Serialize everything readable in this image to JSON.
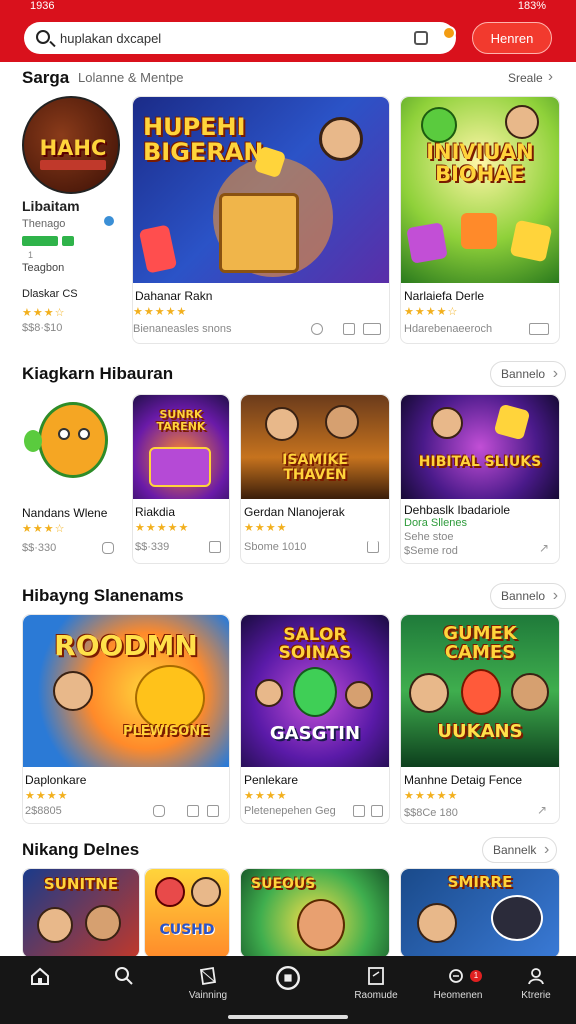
{
  "status": {
    "left": "1936",
    "right": "183%"
  },
  "search": {
    "value": "huplakan dxcapel",
    "button": "Henren"
  },
  "sections": [
    {
      "title": "Sarga",
      "subtitle": "Lolanne & Mentpe",
      "more": "Sreale"
    },
    {
      "title": "Kiagkarn Hibauran",
      "more": "Bannelo"
    },
    {
      "title": "Hibayng Slanenams",
      "more": "Bannelo"
    },
    {
      "title": "Nikang Delnes",
      "more": "Bannelk"
    }
  ],
  "s1": {
    "app": {
      "name": "Libaitam",
      "sub": "Thenago",
      "badge": "1",
      "line3": "Teagbon",
      "label": "Dlaskar CS",
      "price": "$$8·$10",
      "art": "HAHC"
    },
    "cards": [
      {
        "name": "Dahanar Rakn",
        "meta": "Bienaneasles snons",
        "art": "HUPEHI BIGERAN"
      },
      {
        "name": "Narlaiefa Derle",
        "meta": "Hdarebenaeeroch",
        "art": "INIVIUAN BIOHAE"
      }
    ]
  },
  "s2": {
    "cards": [
      {
        "name": "Nandans Wlene",
        "meta": "$$·330"
      },
      {
        "name": "Riakdia",
        "meta": "$$·339",
        "art": "SUNRK TARENK"
      },
      {
        "name": "Gerdan Nlanojerak",
        "meta": "Sbome 1010",
        "art": "ISAMIKE THAVEN"
      },
      {
        "name": "Dehbaslk Ibadariole",
        "sub": "Dora Sllenes",
        "meta": "Sehe stoe",
        "meta2": "$Seme rod",
        "art": "HIBITAL SLIUKS"
      }
    ]
  },
  "s3": {
    "cards": [
      {
        "name": "Daplonkare",
        "meta": "2$8805",
        "art": "ROODMN",
        "art2": "PLEWISONE"
      },
      {
        "name": "Penlekare",
        "meta": "Pletenepehen Geg",
        "art": "SALOR SOINAS",
        "art2": "GASGTIN"
      },
      {
        "name": "Manhne Detaig Fence",
        "meta": "$$8Ce 180",
        "art": "GUMEK CAMES",
        "art2": "UUKANS"
      }
    ]
  },
  "s4": {
    "arts": [
      "SUNITNE",
      "CUSHD",
      "SUEOUS",
      "SMIRRE"
    ]
  },
  "nav": [
    {
      "label": "",
      "icon": "home-icon"
    },
    {
      "label": "",
      "icon": "search-icon"
    },
    {
      "label": "Vainning",
      "icon": "cube-icon"
    },
    {
      "label": "",
      "icon": "play-icon"
    },
    {
      "label": "Raomude",
      "icon": "exit-icon"
    },
    {
      "label": "Heomenen",
      "icon": "bell-icon",
      "badge": "1"
    },
    {
      "label": "Ktrerie",
      "icon": "profile-icon"
    }
  ],
  "colors": {
    "brand": "#d9111c",
    "accent": "#f23a2e",
    "star": "#f2b01e"
  }
}
